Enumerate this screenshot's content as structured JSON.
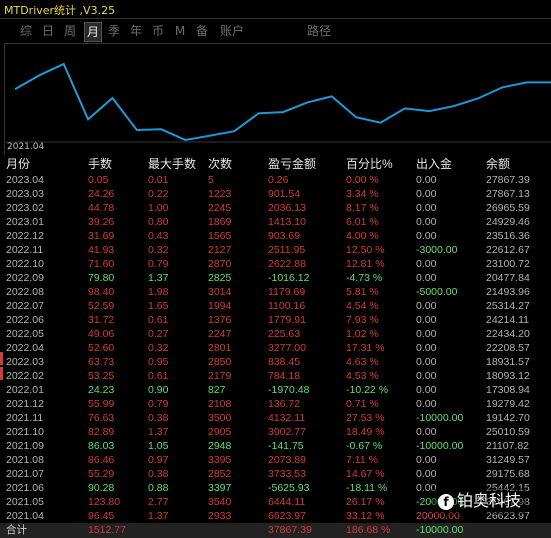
{
  "window": {
    "title": "MTDriver统计 ,V3.25"
  },
  "tabs": [
    {
      "label": "综"
    },
    {
      "label": "日"
    },
    {
      "label": "周"
    },
    {
      "label": "月"
    },
    {
      "label": "季"
    },
    {
      "label": "年"
    },
    {
      "label": "币"
    },
    {
      "label": "M"
    },
    {
      "label": "备"
    },
    {
      "label": "账户"
    },
    {
      "label": "路径"
    }
  ],
  "active_tab": "月",
  "chart": {
    "x_start_label": "2021.04",
    "line_color": "#1e9bd6",
    "equity": [
      26623.97,
      29175.68,
      31249.57,
      21107.82,
      25010.59,
      19142.7,
      19279.42,
      17308.94,
      18093.12,
      18931.57,
      22208.57,
      22434.2,
      24214.11,
      25314.27,
      21493.96,
      20477.84,
      23100.72,
      22612.67,
      23516.36,
      24929.46,
      26965.59,
      27867.13,
      27867.39
    ]
  },
  "table": {
    "headers": [
      "月份",
      "手数",
      "最大手数",
      "次数",
      "盈亏金额",
      "百分比%",
      "出入金",
      "余额"
    ],
    "rows": [
      {
        "month": "2023.04",
        "lots": "0.05",
        "max_lots": "0.01",
        "count": "5",
        "pnl": "0.26",
        "pct": "0.00 %",
        "flow": "0.00",
        "balance": "27867.39",
        "tone": "red",
        "flow_tone": ""
      },
      {
        "month": "2023.03",
        "lots": "24.26",
        "max_lots": "0.22",
        "count": "1223",
        "pnl": "901.54",
        "pct": "3.34 %",
        "flow": "0.00",
        "balance": "27867.13",
        "tone": "red",
        "flow_tone": ""
      },
      {
        "month": "2023.02",
        "lots": "44.78",
        "max_lots": "1.00",
        "count": "2245",
        "pnl": "2036.13",
        "pct": "8.17 %",
        "flow": "0.00",
        "balance": "26965.59",
        "tone": "red",
        "flow_tone": ""
      },
      {
        "month": "2023.01",
        "lots": "39.26",
        "max_lots": "0.80",
        "count": "1869",
        "pnl": "1413.10",
        "pct": "6.01 %",
        "flow": "0.00",
        "balance": "24929.46",
        "tone": "red",
        "flow_tone": ""
      },
      {
        "month": "2022.12",
        "lots": "31.69",
        "max_lots": "0.43",
        "count": "1565",
        "pnl": "903.69",
        "pct": "4.00 %",
        "flow": "0.00",
        "balance": "23516.36",
        "tone": "red",
        "flow_tone": ""
      },
      {
        "month": "2022.11",
        "lots": "41.93",
        "max_lots": "0.32",
        "count": "2127",
        "pnl": "2511.95",
        "pct": "12.50 %",
        "flow": "-3000.00",
        "balance": "22612.67",
        "tone": "red",
        "flow_tone": "neg"
      },
      {
        "month": "2022.10",
        "lots": "71.60",
        "max_lots": "0.79",
        "count": "2870",
        "pnl": "2622.88",
        "pct": "12.81 %",
        "flow": "0.00",
        "balance": "23100.72",
        "tone": "red",
        "flow_tone": ""
      },
      {
        "month": "2022.09",
        "lots": "79.80",
        "max_lots": "1.37",
        "count": "2825",
        "pnl": "-1016.12",
        "pct": "-4.73 %",
        "flow": "0.00",
        "balance": "20477.84",
        "tone": "green",
        "flow_tone": ""
      },
      {
        "month": "2022.08",
        "lots": "98.40",
        "max_lots": "1.98",
        "count": "3014",
        "pnl": "1179.69",
        "pct": "5.81 %",
        "flow": "-5000.00",
        "balance": "21493.96",
        "tone": "red",
        "flow_tone": "neg"
      },
      {
        "month": "2022.07",
        "lots": "52.59",
        "max_lots": "1.65",
        "count": "1994",
        "pnl": "1100.16",
        "pct": "4.54 %",
        "flow": "0.00",
        "balance": "25314.27",
        "tone": "red",
        "flow_tone": ""
      },
      {
        "month": "2022.06",
        "lots": "31.72",
        "max_lots": "0.61",
        "count": "1376",
        "pnl": "1779.91",
        "pct": "7.93 %",
        "flow": "0.00",
        "balance": "24214.11",
        "tone": "red",
        "flow_tone": ""
      },
      {
        "month": "2022.05",
        "lots": "49.06",
        "max_lots": "0.27",
        "count": "2247",
        "pnl": "225.63",
        "pct": "1.02 %",
        "flow": "0.00",
        "balance": "22434.20",
        "tone": "red",
        "flow_tone": ""
      },
      {
        "month": "2022.04",
        "lots": "52.60",
        "max_lots": "0.32",
        "count": "2801",
        "pnl": "3277.00",
        "pct": "17.31 %",
        "flow": "0.00",
        "balance": "22208.57",
        "tone": "red",
        "flow_tone": ""
      },
      {
        "month": "2022.03",
        "lots": "63.73",
        "max_lots": "0.95",
        "count": "2850",
        "pnl": "838.45",
        "pct": "4.63 %",
        "flow": "0.00",
        "balance": "18931.57",
        "tone": "red",
        "flow_tone": ""
      },
      {
        "month": "2022.02",
        "lots": "53.25",
        "max_lots": "0.61",
        "count": "2179",
        "pnl": "784.18",
        "pct": "4.53 %",
        "flow": "0.00",
        "balance": "18093.12",
        "tone": "red",
        "flow_tone": ""
      },
      {
        "month": "2022.01",
        "lots": "24.23",
        "max_lots": "0.90",
        "count": "827",
        "pnl": "-1970.48",
        "pct": "-10.22 %",
        "flow": "0.00",
        "balance": "17308.94",
        "tone": "green",
        "flow_tone": ""
      },
      {
        "month": "2021.12",
        "lots": "55.99",
        "max_lots": "0.79",
        "count": "2108",
        "pnl": "136.72",
        "pct": "0.71 %",
        "flow": "0.00",
        "balance": "19279.42",
        "tone": "red",
        "flow_tone": ""
      },
      {
        "month": "2021.11",
        "lots": "76.63",
        "max_lots": "0.38",
        "count": "3500",
        "pnl": "4132.11",
        "pct": "27.53 %",
        "flow": "-10000.00",
        "balance": "19142.70",
        "tone": "red",
        "flow_tone": "neg"
      },
      {
        "month": "2021.10",
        "lots": "82.89",
        "max_lots": "1.37",
        "count": "2905",
        "pnl": "3902.77",
        "pct": "18.49 %",
        "flow": "0.00",
        "balance": "25010.59",
        "tone": "red",
        "flow_tone": ""
      },
      {
        "month": "2021.09",
        "lots": "86.03",
        "max_lots": "1.05",
        "count": "2948",
        "pnl": "-141.75",
        "pct": "-0.67 %",
        "flow": "-10000.00",
        "balance": "21107.82",
        "tone": "green",
        "flow_tone": "neg"
      },
      {
        "month": "2021.08",
        "lots": "86.46",
        "max_lots": "0.97",
        "count": "3395",
        "pnl": "2073.89",
        "pct": "7.11 %",
        "flow": "0.00",
        "balance": "31249.57",
        "tone": "red",
        "flow_tone": ""
      },
      {
        "month": "2021.07",
        "lots": "55.29",
        "max_lots": "0.38",
        "count": "2852",
        "pnl": "3733.53",
        "pct": "14.67 %",
        "flow": "0.00",
        "balance": "29175.68",
        "tone": "red",
        "flow_tone": ""
      },
      {
        "month": "2021.06",
        "lots": "90.28",
        "max_lots": "0.88",
        "count": "3397",
        "pnl": "-5625.93",
        "pct": "-18.11 %",
        "flow": "0.00",
        "balance": "25442.15",
        "tone": "green",
        "flow_tone": ""
      },
      {
        "month": "2021.05",
        "lots": "123.80",
        "max_lots": "2.77",
        "count": "3540",
        "pnl": "6444.11",
        "pct": "26.17 %",
        "flow": "-20000.00",
        "balance": "31067.98",
        "tone": "red",
        "flow_tone": "neg"
      },
      {
        "month": "2021.04",
        "lots": "96.45",
        "max_lots": "1.37",
        "count": "2933",
        "pnl": "6623.97",
        "pct": "33.12 %",
        "flow": "20000.00",
        "balance": "26623.97",
        "tone": "red",
        "flow_tone": "pos"
      }
    ],
    "total": {
      "label": "合计",
      "lots": "1512.77",
      "pnl": "37867.39",
      "pct": "186.68 %",
      "flow": "-10000.00"
    }
  },
  "watermark": {
    "logo": "f",
    "text": "铂奥科技"
  }
}
